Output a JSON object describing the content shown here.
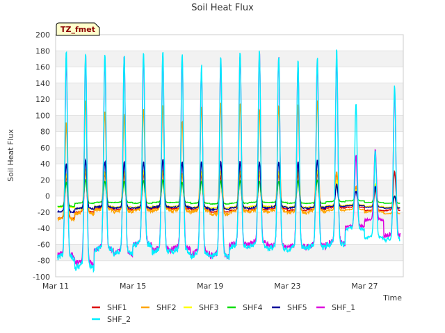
{
  "chart_data": {
    "type": "line",
    "title": "Soil Heat Flux",
    "xlabel": "Time",
    "ylabel": "Soil Heat Flux",
    "badge": "TZ_fmet",
    "ylim": [
      -100,
      200
    ],
    "yticks": [
      -100,
      -80,
      -60,
      -40,
      -20,
      0,
      20,
      40,
      60,
      80,
      100,
      120,
      140,
      160,
      180,
      200
    ],
    "xlim": [
      "2024-03-11",
      "2024-03-29"
    ],
    "xticks": [
      {
        "value": "2024-03-11",
        "label": "Mar 11"
      },
      {
        "value": "2024-03-15",
        "label": "Mar 15"
      },
      {
        "value": "2024-03-19",
        "label": "Mar 19"
      },
      {
        "value": "2024-03-23",
        "label": "Mar 23"
      },
      {
        "value": "2024-03-27",
        "label": "Mar 27"
      }
    ],
    "grid": "horizontal bands",
    "legend_position": "bottom",
    "x_dates": [
      "2024-03-11",
      "2024-03-12",
      "2024-03-13",
      "2024-03-14",
      "2024-03-15",
      "2024-03-16",
      "2024-03-17",
      "2024-03-18",
      "2024-03-19",
      "2024-03-20",
      "2024-03-21",
      "2024-03-22",
      "2024-03-23",
      "2024-03-24",
      "2024-03-25",
      "2024-03-26",
      "2024-03-27",
      "2024-03-28"
    ],
    "series": [
      {
        "name": "SHF1",
        "color": "#dd0000",
        "daily_min": [
          -28,
          -20,
          -16,
          -17,
          -17,
          -15,
          -16,
          -17,
          -20,
          -18,
          -17,
          -16,
          -18,
          -17,
          -15,
          -14,
          -18,
          -18
        ],
        "daily_max": [
          25,
          30,
          28,
          27,
          28,
          30,
          27,
          26,
          25,
          27,
          28,
          26,
          27,
          29,
          28,
          10,
          8,
          30
        ]
      },
      {
        "name": "SHF2",
        "color": "#ffa500",
        "daily_min": [
          -29,
          -22,
          -18,
          -20,
          -19,
          -18,
          -19,
          -20,
          -24,
          -20,
          -20,
          -19,
          -21,
          -20,
          -18,
          -17,
          -20,
          -22
        ],
        "daily_max": [
          90,
          118,
          103,
          100,
          108,
          112,
          93,
          110,
          115,
          115,
          107,
          111,
          112,
          118,
          30,
          12,
          48,
          0
        ]
      },
      {
        "name": "SHF3",
        "color": "#ffff00",
        "daily_min": [
          -14,
          -16,
          -13,
          -14,
          -14,
          -13,
          -13,
          -14,
          -15,
          -14,
          -13,
          -13,
          -14,
          -14,
          -12,
          -11,
          -13,
          -14
        ],
        "daily_max": [
          27,
          33,
          30,
          30,
          31,
          32,
          28,
          30,
          31,
          31,
          30,
          30,
          31,
          32,
          20,
          8,
          15,
          0
        ]
      },
      {
        "name": "SHF4",
        "color": "#00dd00",
        "daily_min": [
          -13,
          -9,
          -8,
          -8,
          -9,
          -8,
          -8,
          -9,
          -10,
          -9,
          -8,
          -8,
          -9,
          -9,
          -7,
          -6,
          -8,
          -9
        ],
        "daily_max": [
          17,
          20,
          18,
          18,
          19,
          20,
          17,
          18,
          19,
          19,
          18,
          18,
          19,
          20,
          12,
          5,
          10,
          0
        ]
      },
      {
        "name": "SHF5",
        "color": "#000099",
        "daily_min": [
          -20,
          -16,
          -14,
          -15,
          -15,
          -14,
          -14,
          -15,
          -17,
          -15,
          -15,
          -14,
          -15,
          -15,
          -13,
          -12,
          -14,
          -15
        ],
        "daily_max": [
          40,
          44,
          42,
          42,
          42,
          45,
          42,
          42,
          42,
          42,
          42,
          42,
          42,
          44,
          15,
          6,
          12,
          0
        ]
      },
      {
        "name": "SHF_1",
        "color": "#dd00dd",
        "daily_min": [
          -75,
          -85,
          -67,
          -72,
          -60,
          -68,
          -66,
          -72,
          -75,
          -62,
          -60,
          -63,
          -64,
          -63,
          -60,
          -38,
          -30,
          -50
        ],
        "daily_max": [
          168,
          172,
          170,
          170,
          172,
          170,
          168,
          155,
          170,
          175,
          175,
          170,
          162,
          165,
          170,
          50,
          58,
          130
        ]
      },
      {
        "name": "SHF_2",
        "color": "#00eeff",
        "daily_min": [
          -78,
          -90,
          -68,
          -73,
          -62,
          -70,
          -70,
          -75,
          -76,
          -64,
          -63,
          -66,
          -66,
          -65,
          -62,
          -42,
          -52,
          -55
        ],
        "daily_max": [
          178,
          178,
          172,
          172,
          178,
          178,
          175,
          160,
          172,
          178,
          178,
          172,
          168,
          172,
          180,
          115,
          55,
          135
        ]
      }
    ]
  }
}
